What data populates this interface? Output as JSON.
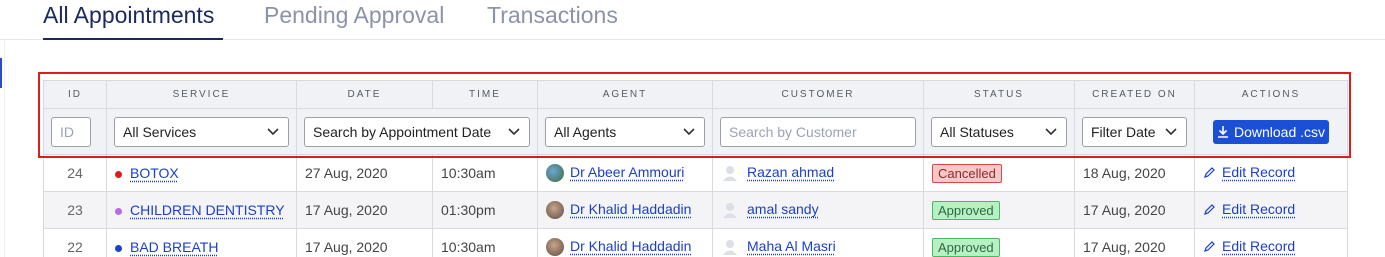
{
  "tabs": [
    {
      "label": "All Appointments",
      "active": true
    },
    {
      "label": "Pending Approval",
      "active": false
    },
    {
      "label": "Transactions",
      "active": false
    }
  ],
  "table": {
    "headers": {
      "id": "ID",
      "service": "SERVICE",
      "date": "DATE",
      "time": "TIME",
      "agent": "AGENT",
      "customer": "CUSTOMER",
      "status": "STATUS",
      "created_on": "CREATED ON",
      "actions": "ACTIONS"
    },
    "filters": {
      "id_placeholder": "ID",
      "service_selected": "All Services",
      "date_selected": "Search by Appointment Date",
      "agent_selected": "All Agents",
      "customer_placeholder": "Search by Customer",
      "status_selected": "All Statuses",
      "created_selected": "Filter Date",
      "download_label": "Download .csv"
    },
    "rows": [
      {
        "id": "24",
        "service": "BOTOX",
        "service_color": "#e01b1b",
        "date": "27 Aug, 2020",
        "time": "10:30am",
        "agent": "Dr Abeer Ammouri",
        "customer": "Razan ahmad",
        "status": "Cancelled",
        "created_on": "18 Aug, 2020",
        "action": "Edit Record"
      },
      {
        "id": "23",
        "service": "CHILDREN DENTISTRY",
        "service_color": "#b86ae8",
        "date": "17 Aug, 2020",
        "time": "01:30pm",
        "agent": "Dr Khalid Haddadin",
        "customer": "amal sandy",
        "status": "Approved",
        "created_on": "17 Aug, 2020",
        "action": "Edit Record"
      },
      {
        "id": "22",
        "service": "BAD BREATH",
        "service_color": "#1a3fd6",
        "date": "17 Aug, 2020",
        "time": "10:30am",
        "agent": "Dr Khalid Haddadin",
        "customer": "Maha Al Masri",
        "status": "Approved",
        "created_on": "17 Aug, 2020",
        "action": "Edit Record"
      }
    ]
  },
  "icons": {
    "chevron": "chevron-down-icon",
    "download": "download-icon",
    "edit": "pencil-icon",
    "customer": "user-icon"
  },
  "colors": {
    "accent": "#1a4fd6",
    "cancelled_bg": "#f8c8c8",
    "approved_bg": "#b8f0c6",
    "highlight_frame": "#e01b1b"
  }
}
